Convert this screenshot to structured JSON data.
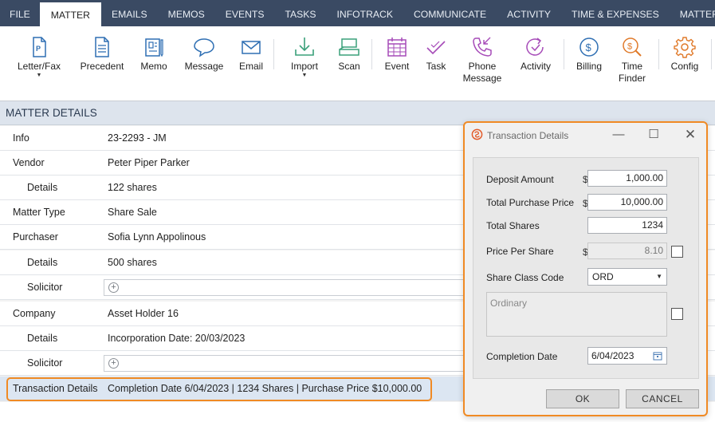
{
  "menu": {
    "tabs": [
      {
        "label": "FILE"
      },
      {
        "label": "MATTER",
        "active": true
      },
      {
        "label": "EMAILS"
      },
      {
        "label": "MEMOS"
      },
      {
        "label": "EVENTS"
      },
      {
        "label": "TASKS"
      },
      {
        "label": "INFOTRACK"
      },
      {
        "label": "COMMUNICATE"
      },
      {
        "label": "ACTIVITY"
      },
      {
        "label": "TIME & EXPENSES"
      },
      {
        "label": "MATTER INSIGHTS"
      }
    ]
  },
  "ribbon": {
    "letter_fax": "Letter/Fax",
    "precedent": "Precedent",
    "memo": "Memo",
    "message": "Message",
    "email": "Email",
    "import": "Import",
    "scan": "Scan",
    "event": "Event",
    "task": "Task",
    "phone_message_line1": "Phone",
    "phone_message_line2": "Message",
    "activity": "Activity",
    "billing": "Billing",
    "time_finder_line1": "Time",
    "time_finder_line2": "Finder",
    "config": "Config",
    "colors": {
      "blue": "#2f6fb3",
      "green": "#3aa07a",
      "purple": "#a64bb8",
      "orange": "#e07a2a"
    }
  },
  "section": {
    "title": "MATTER DETAILS"
  },
  "details": {
    "info": {
      "label": "Info",
      "value": "23-2293 - JM"
    },
    "vendor": {
      "label": "Vendor",
      "value": "Peter Piper Parker"
    },
    "vendor_details": {
      "label": "Details",
      "value": "122 shares"
    },
    "matter_type": {
      "label": "Matter Type",
      "value": "Share Sale"
    },
    "purchaser": {
      "label": "Purchaser",
      "value": "Sofia Lynn Appolinous"
    },
    "purchaser_details": {
      "label": "Details",
      "value": "500 shares"
    },
    "purchaser_solicitor": {
      "label": "Solicitor"
    },
    "company": {
      "label": "Company",
      "value": "Asset Holder 16"
    },
    "company_details": {
      "label": "Details",
      "value": "Incorporation Date: 20/03/2023"
    },
    "company_solicitor": {
      "label": "Solicitor"
    },
    "transaction": {
      "label": "Transaction Details",
      "value": "Completion Date 6/04/2023 | 1234 Shares | Purchase Price $10,000.00"
    }
  },
  "dialog": {
    "title": "Transaction Details",
    "deposit_label": "Deposit Amount",
    "deposit_currency": "$",
    "deposit_value": "1,000.00",
    "purchase_label": "Total Purchase Price",
    "purchase_currency": "$",
    "purchase_value": "10,000.00",
    "shares_label": "Total Shares",
    "shares_value": "1234",
    "pps_label": "Price Per Share",
    "pps_currency": "$",
    "pps_value": "8.10",
    "class_label": "Share Class Code",
    "class_value": "ORD",
    "class_desc": "Ordinary",
    "completion_label": "Completion Date",
    "completion_value": "6/04/2023",
    "ok_label": "OK",
    "cancel_label": "CANCEL",
    "accent": "#f08a24"
  }
}
